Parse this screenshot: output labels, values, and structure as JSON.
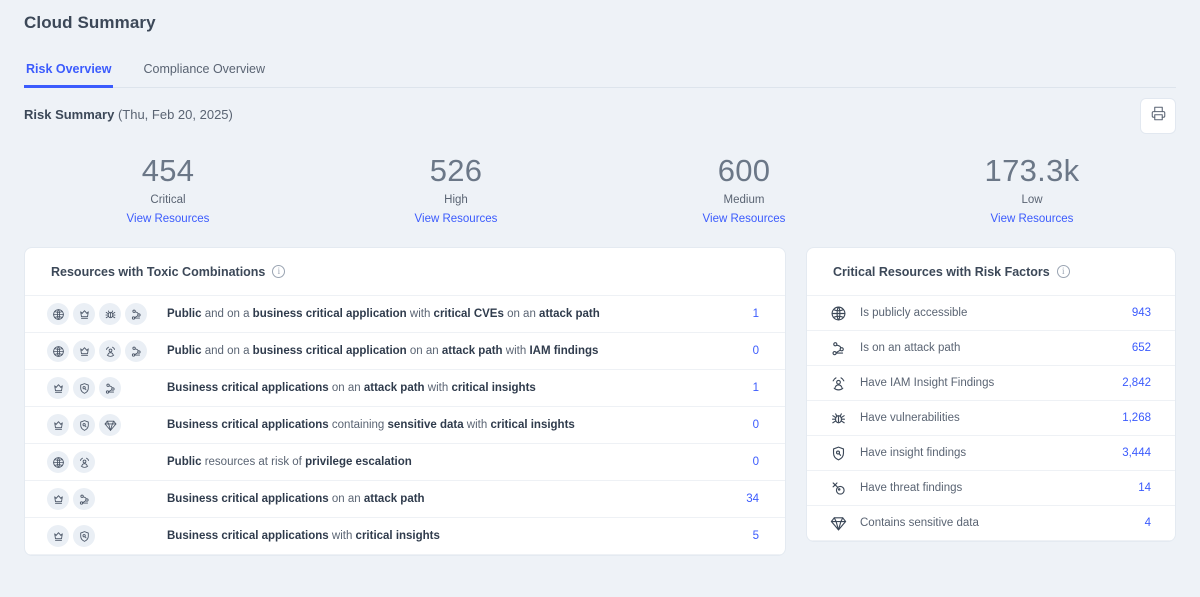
{
  "header": {
    "title": "Cloud Summary",
    "tabs": [
      {
        "label": "Risk Overview",
        "active": true
      },
      {
        "label": "Compliance Overview",
        "active": false
      }
    ]
  },
  "risk_summary": {
    "title": "Risk Summary",
    "date": "(Thu, Feb 20, 2025)",
    "print_icon": "printer-icon",
    "kpis": [
      {
        "value": "454",
        "label": "Critical",
        "link": "View Resources"
      },
      {
        "value": "526",
        "label": "High",
        "link": "View Resources"
      },
      {
        "value": "600",
        "label": "Medium",
        "link": "View Resources"
      },
      {
        "value": "173.3k",
        "label": "Low",
        "link": "View Resources"
      }
    ]
  },
  "toxic_panel": {
    "title": "Resources with Toxic Combinations",
    "info_icon": "info-icon",
    "rows": [
      {
        "icons": [
          "globe-icon",
          "crown-icon",
          "bug-icon",
          "attack-path-icon"
        ],
        "parts": [
          {
            "t": "Public",
            "b": true
          },
          {
            "t": " and on a ",
            "b": false
          },
          {
            "t": "business critical application",
            "b": true
          },
          {
            "t": " with ",
            "b": false
          },
          {
            "t": "critical CVEs",
            "b": true
          },
          {
            "t": " on an ",
            "b": false
          },
          {
            "t": "attack path",
            "b": true
          }
        ],
        "count": "1"
      },
      {
        "icons": [
          "globe-icon",
          "crown-icon",
          "iam-icon",
          "attack-path-icon"
        ],
        "parts": [
          {
            "t": "Public",
            "b": true
          },
          {
            "t": " and on a ",
            "b": false
          },
          {
            "t": "business critical application",
            "b": true
          },
          {
            "t": " on an ",
            "b": false
          },
          {
            "t": "attack path",
            "b": true
          },
          {
            "t": " with ",
            "b": false
          },
          {
            "t": "IAM findings",
            "b": true
          }
        ],
        "count": "0"
      },
      {
        "icons": [
          "crown-icon",
          "insight-shield-icon",
          "attack-path-icon"
        ],
        "parts": [
          {
            "t": "Business critical applications",
            "b": true
          },
          {
            "t": " on an ",
            "b": false
          },
          {
            "t": "attack path",
            "b": true
          },
          {
            "t": " with ",
            "b": false
          },
          {
            "t": "critical insights",
            "b": true
          }
        ],
        "count": "1"
      },
      {
        "icons": [
          "crown-icon",
          "insight-shield-icon",
          "gem-icon"
        ],
        "parts": [
          {
            "t": "Business critical applications",
            "b": true
          },
          {
            "t": " containing ",
            "b": false
          },
          {
            "t": "sensitive data",
            "b": true
          },
          {
            "t": " with ",
            "b": false
          },
          {
            "t": "critical insights",
            "b": true
          }
        ],
        "count": "0"
      },
      {
        "icons": [
          "globe-icon",
          "iam-icon"
        ],
        "parts": [
          {
            "t": "Public",
            "b": true
          },
          {
            "t": " resources at risk of ",
            "b": false
          },
          {
            "t": "privilege escalation",
            "b": true
          }
        ],
        "count": "0"
      },
      {
        "icons": [
          "crown-icon",
          "attack-path-icon"
        ],
        "parts": [
          {
            "t": "Business critical applications",
            "b": true
          },
          {
            "t": " on an ",
            "b": false
          },
          {
            "t": "attack path",
            "b": true
          }
        ],
        "count": "34"
      },
      {
        "icons": [
          "crown-icon",
          "insight-shield-icon"
        ],
        "parts": [
          {
            "t": "Business critical applications",
            "b": true
          },
          {
            "t": " with ",
            "b": false
          },
          {
            "t": "critical insights",
            "b": true
          }
        ],
        "count": "5"
      }
    ]
  },
  "risk_factors_panel": {
    "title": "Critical Resources with Risk Factors",
    "info_icon": "info-icon",
    "rows": [
      {
        "icon": "globe-icon",
        "label": "Is publicly accessible",
        "count": "943"
      },
      {
        "icon": "attack-path-icon",
        "label": "Is on an attack path",
        "count": "652"
      },
      {
        "icon": "iam-icon",
        "label": "Have IAM Insight Findings",
        "count": "2,842"
      },
      {
        "icon": "bug-icon",
        "label": "Have vulnerabilities",
        "count": "1,268"
      },
      {
        "icon": "insight-shield-icon",
        "label": "Have insight findings",
        "count": "3,444"
      },
      {
        "icon": "threat-icon",
        "label": "Have threat findings",
        "count": "14"
      },
      {
        "icon": "gem-icon",
        "label": "Contains sensitive data",
        "count": "4"
      }
    ]
  },
  "colors": {
    "accent": "#3b5bfd",
    "page_background": "#eef2f7",
    "card_background": "#ffffff",
    "text_primary": "#3c4858",
    "text_secondary": "#5a6473",
    "chip_background": "#eaeff5"
  }
}
